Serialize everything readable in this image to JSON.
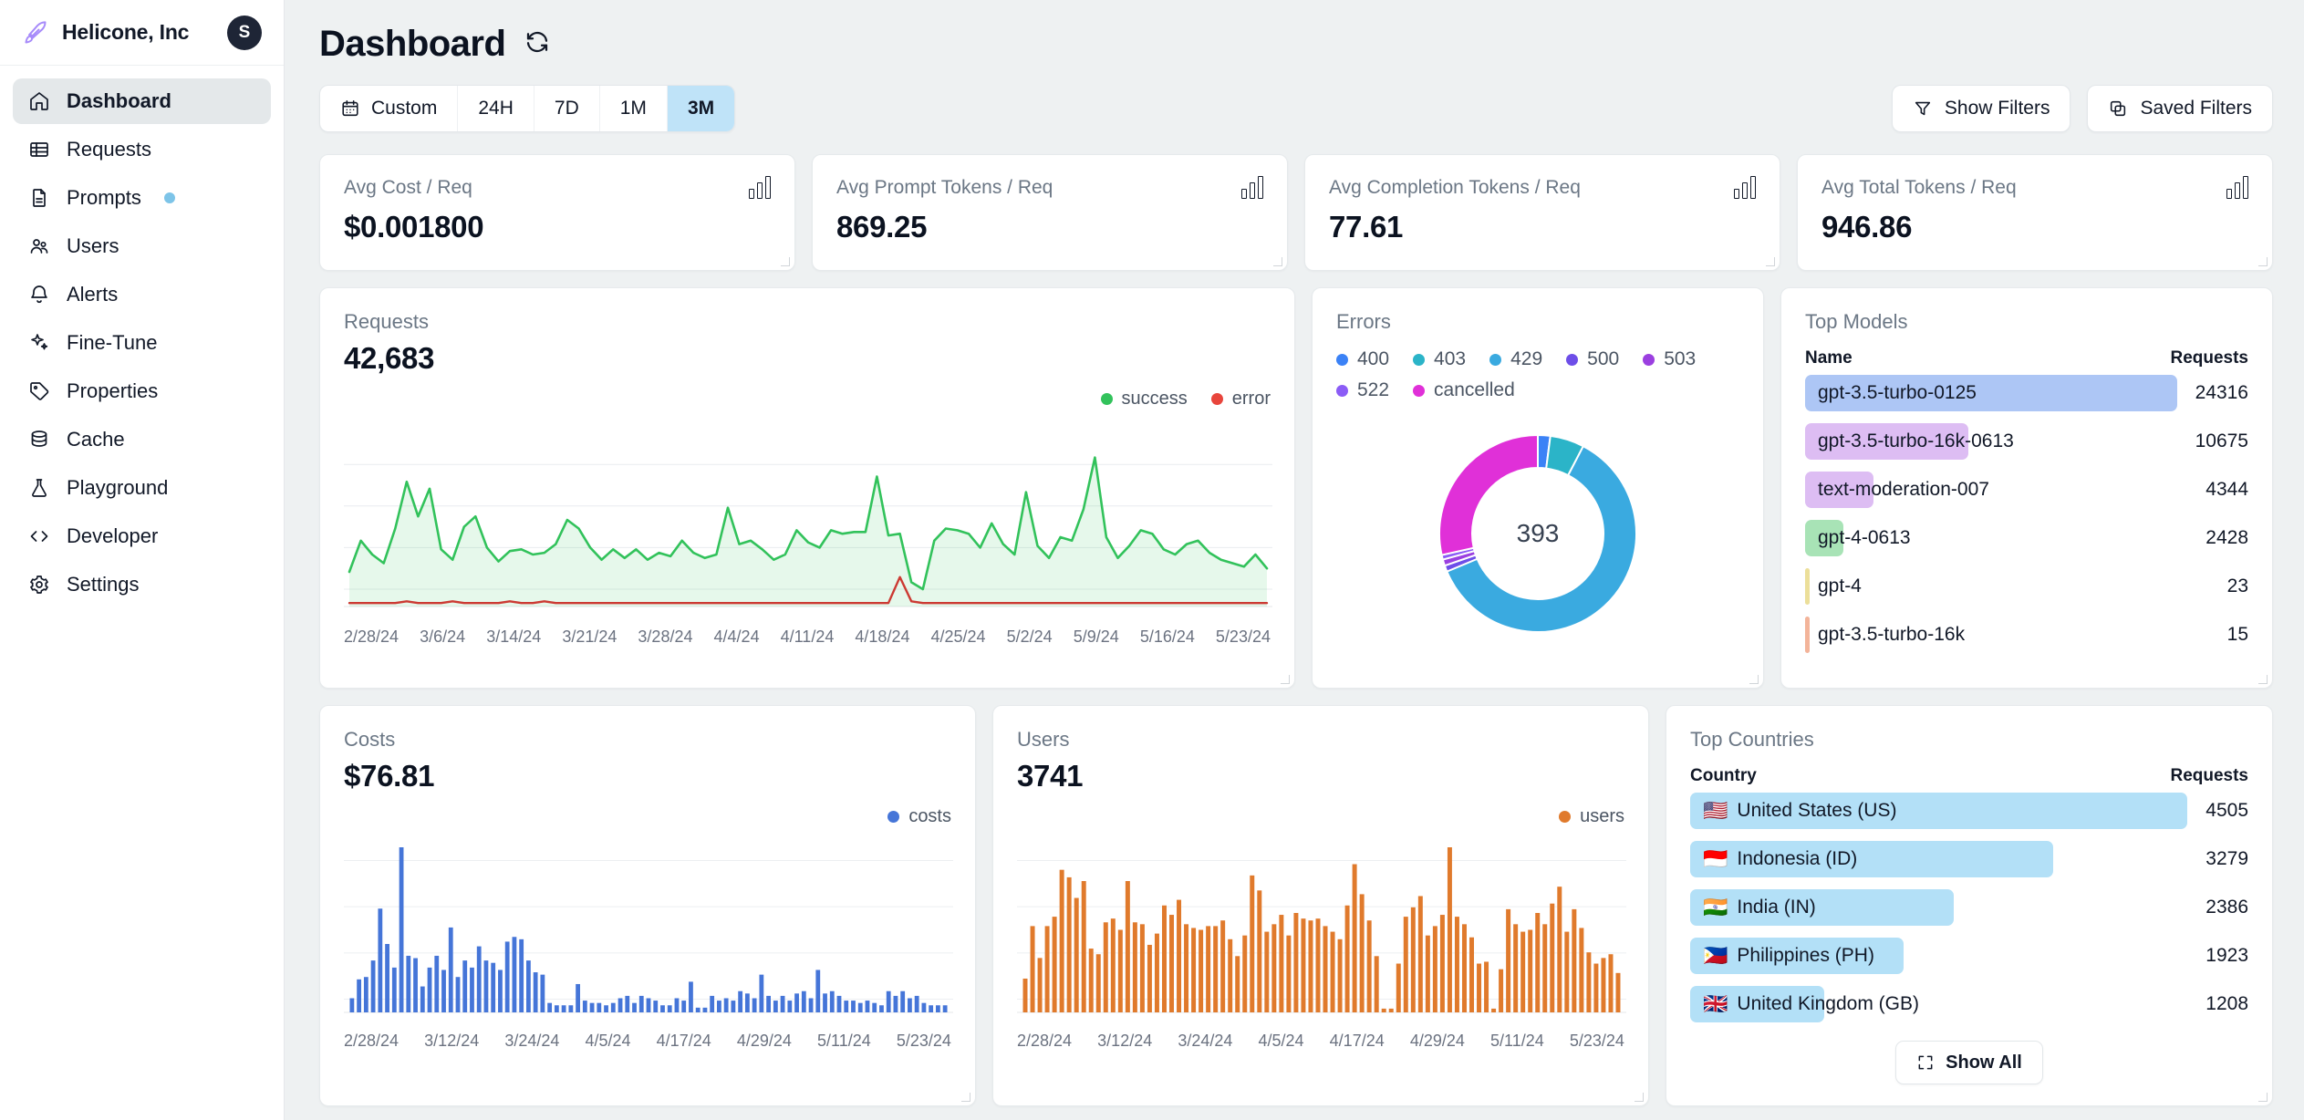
{
  "sidebar": {
    "brand": "Helicone, Inc",
    "avatar_initial": "S",
    "items": [
      {
        "label": "Dashboard",
        "icon": "home-icon",
        "active": true
      },
      {
        "label": "Requests",
        "icon": "table-icon",
        "active": false
      },
      {
        "label": "Prompts",
        "icon": "document-icon",
        "active": false,
        "badge": true
      },
      {
        "label": "Users",
        "icon": "users-icon",
        "active": false
      },
      {
        "label": "Alerts",
        "icon": "bell-icon",
        "active": false
      },
      {
        "label": "Fine-Tune",
        "icon": "sparkles-icon",
        "active": false
      },
      {
        "label": "Properties",
        "icon": "tag-icon",
        "active": false
      },
      {
        "label": "Cache",
        "icon": "database-icon",
        "active": false
      },
      {
        "label": "Playground",
        "icon": "beaker-icon",
        "active": false
      },
      {
        "label": "Developer",
        "icon": "code-icon",
        "active": false
      },
      {
        "label": "Settings",
        "icon": "gear-icon",
        "active": false
      }
    ]
  },
  "header": {
    "title": "Dashboard",
    "refresh_icon": "refresh-icon"
  },
  "toolbar": {
    "ranges": [
      {
        "label": "Custom",
        "icon": "calendar-icon",
        "active": false
      },
      {
        "label": "24H",
        "active": false
      },
      {
        "label": "7D",
        "active": false
      },
      {
        "label": "1M",
        "active": false
      },
      {
        "label": "3M",
        "active": true
      }
    ],
    "show_filters": "Show Filters",
    "saved_filters": "Saved Filters"
  },
  "kpis": [
    {
      "label": "Avg Cost / Req",
      "value": "$0.001800"
    },
    {
      "label": "Avg Prompt Tokens / Req",
      "value": "869.25"
    },
    {
      "label": "Avg Completion Tokens / Req",
      "value": "77.61"
    },
    {
      "label": "Avg Total Tokens / Req",
      "value": "946.86"
    }
  ],
  "panels": {
    "requests": {
      "title": "Requests",
      "value": "42,683"
    },
    "errors": {
      "title": "Errors",
      "center": "393"
    },
    "top_models": {
      "title": "Top Models",
      "col_name": "Name",
      "col_requests": "Requests"
    },
    "costs": {
      "title": "Costs",
      "value": "$76.81"
    },
    "users": {
      "title": "Users",
      "value": "3741"
    },
    "top_countries": {
      "title": "Top Countries",
      "col_country": "Country",
      "col_requests": "Requests",
      "show_all": "Show All"
    }
  },
  "top_models": [
    {
      "name": "gpt-3.5-turbo-0125",
      "requests": "24316",
      "pct": 100,
      "color": "#adc6f5"
    },
    {
      "name": "gpt-3.5-turbo-16k-0613",
      "requests": "10675",
      "pct": 44,
      "color": "#ddbdf3"
    },
    {
      "name": "text-moderation-007",
      "requests": "4344",
      "pct": 18,
      "color": "#ddbdf3"
    },
    {
      "name": "gpt-4-0613",
      "requests": "2428",
      "pct": 10,
      "color": "#a8e3b6"
    },
    {
      "name": "gpt-4",
      "requests": "23",
      "pct": 1.2,
      "color": "#ecdf9a"
    },
    {
      "name": "gpt-3.5-turbo-16k",
      "requests": "15",
      "pct": 1.2,
      "color": "#f3b49a"
    }
  ],
  "top_countries": [
    {
      "flag": "🇺🇸",
      "name": "United States (US)",
      "requests": "4505",
      "pct": 100
    },
    {
      "flag": "🇮🇩",
      "name": "Indonesia (ID)",
      "requests": "3279",
      "pct": 73
    },
    {
      "flag": "🇮🇳",
      "name": "India (IN)",
      "requests": "2386",
      "pct": 53
    },
    {
      "flag": "🇵🇭",
      "name": "Philippines (PH)",
      "requests": "1923",
      "pct": 43
    },
    {
      "flag": "🇬🇧",
      "name": "United Kingdom (GB)",
      "requests": "1208",
      "pct": 27
    }
  ],
  "chart_data": [
    {
      "type": "area",
      "title": "Requests",
      "total": "42,683",
      "legend": [
        {
          "name": "success",
          "color": "#32c25b"
        },
        {
          "name": "error",
          "color": "#e8453c"
        }
      ],
      "legend_position": "top-right",
      "grid": true,
      "xlabel": "",
      "ylabel": "",
      "tick_labels": [
        "2/28/24",
        "3/6/24",
        "3/14/24",
        "3/21/24",
        "3/28/24",
        "4/4/24",
        "4/11/24",
        "4/18/24",
        "4/25/24",
        "5/2/24",
        "5/9/24",
        "5/16/24",
        "5/23/24"
      ],
      "ylim": [
        0,
        100
      ],
      "series": [
        {
          "name": "success",
          "values": [
            20,
            38,
            30,
            25,
            45,
            72,
            52,
            68,
            33,
            27,
            46,
            52,
            34,
            26,
            32,
            33,
            30,
            31,
            36,
            50,
            45,
            34,
            27,
            33,
            28,
            33,
            27,
            31,
            29,
            38,
            31,
            28,
            30,
            57,
            36,
            38,
            33,
            27,
            30,
            44,
            37,
            34,
            44,
            42,
            43,
            43,
            75,
            41,
            42,
            14,
            10,
            38,
            45,
            44,
            42,
            34,
            48,
            36,
            30,
            66,
            35,
            28,
            40,
            38,
            56,
            86,
            40,
            28,
            35,
            44,
            42,
            33,
            30,
            36,
            38,
            31,
            27,
            25,
            23,
            30,
            22
          ]
        },
        {
          "name": "error",
          "values": [
            2,
            2,
            2,
            2,
            2,
            3,
            2,
            2,
            2,
            3,
            2,
            2,
            2,
            2,
            3,
            2,
            2,
            3,
            2,
            2,
            2,
            2,
            2,
            2,
            2,
            2,
            2,
            2,
            2,
            2,
            2,
            2,
            2,
            2,
            2,
            2,
            2,
            2,
            2,
            2,
            2,
            2,
            2,
            2,
            2,
            2,
            2,
            2,
            17,
            3,
            2,
            2,
            2,
            2,
            2,
            2,
            2,
            2,
            2,
            2,
            2,
            2,
            2,
            2,
            2,
            2,
            2,
            2,
            2,
            2,
            2,
            2,
            2,
            2,
            2,
            2,
            2,
            2,
            2,
            2,
            2
          ]
        }
      ]
    },
    {
      "type": "pie",
      "title": "Errors",
      "center_value": "393",
      "labels": [
        "400",
        "403",
        "429",
        "500",
        "503",
        "522",
        "cancelled"
      ],
      "values": [
        8,
        22,
        240,
        4,
        4,
        3,
        112
      ],
      "colors": [
        "#3b82f6",
        "#2bb4c8",
        "#3aaae0",
        "#6d4ee8",
        "#9b3fe0",
        "#8b5cf6",
        "#e030d8"
      ],
      "legend_position": "top-left"
    },
    {
      "type": "bar",
      "title": "Costs",
      "total": "$76.81",
      "legend": [
        {
          "name": "costs",
          "color": "#4575d8"
        }
      ],
      "legend_position": "top-right",
      "grid": true,
      "tick_labels": [
        "2/28/24",
        "3/12/24",
        "3/24/24",
        "4/5/24",
        "4/17/24",
        "4/29/24",
        "5/11/24",
        "5/23/24"
      ],
      "values": [
        6,
        14,
        15,
        22,
        44,
        29,
        19,
        70,
        24,
        23,
        11,
        19,
        24,
        18,
        36,
        15,
        22,
        19,
        28,
        22,
        21,
        18,
        30,
        32,
        31,
        22,
        17,
        16,
        4,
        3,
        3,
        3,
        12,
        5,
        4,
        4,
        3,
        4,
        6,
        7,
        4,
        7,
        6,
        5,
        3,
        3,
        6,
        5,
        13,
        2,
        2,
        7,
        5,
        6,
        5,
        9,
        8,
        6,
        16,
        7,
        5,
        7,
        5,
        8,
        9,
        6,
        18,
        8,
        9,
        7,
        5,
        5,
        4,
        5,
        4,
        3,
        9,
        7,
        9,
        6,
        7,
        4,
        3,
        3,
        3
      ]
    },
    {
      "type": "bar",
      "title": "Users",
      "total": "3741",
      "legend": [
        {
          "name": "users",
          "color": "#e07a2c"
        }
      ],
      "legend_position": "top-right",
      "grid": true,
      "tick_labels": [
        "2/28/24",
        "3/12/24",
        "3/24/24",
        "4/5/24",
        "4/17/24",
        "4/29/24",
        "5/11/24",
        "5/23/24"
      ],
      "values": [
        18,
        46,
        29,
        46,
        51,
        76,
        72,
        61,
        70,
        34,
        31,
        48,
        50,
        44,
        70,
        48,
        47,
        36,
        42,
        57,
        52,
        60,
        47,
        45,
        44,
        46,
        46,
        49,
        39,
        30,
        41,
        73,
        65,
        43,
        47,
        52,
        41,
        53,
        50,
        49,
        50,
        46,
        43,
        39,
        57,
        79,
        63,
        49,
        30,
        2,
        2,
        26,
        51,
        56,
        62,
        41,
        46,
        52,
        88,
        51,
        47,
        40,
        26,
        27,
        2,
        23,
        55,
        47,
        43,
        44,
        53,
        47,
        58,
        67,
        43,
        55,
        45,
        32,
        26,
        29,
        31,
        21
      ]
    }
  ]
}
